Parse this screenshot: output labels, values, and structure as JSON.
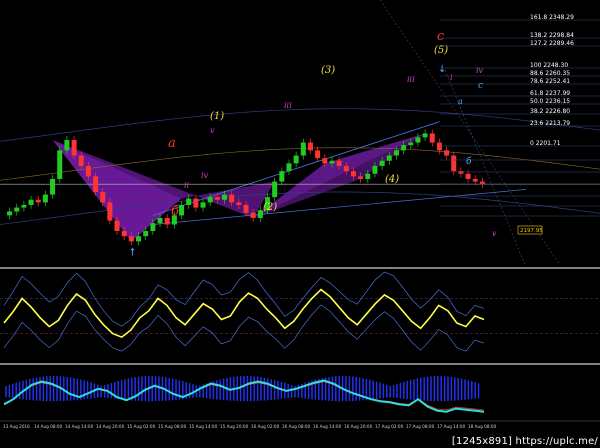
{
  "watermark": "[1245x891] https://uplc.me/",
  "colors": {
    "background": "#000000",
    "bull_candle": "#22cc22",
    "bear_candle": "#ff3333",
    "pattern_fill": "#7a1fb0",
    "channel": "#4a6fd8",
    "fib_line": "#3a4a70",
    "stoch_main": "#ffff44",
    "osc_line": "#33dddd",
    "histogram": "#2233ff",
    "wave_yellow": "#f0e040",
    "wave_magenta": "#cc44cc",
    "wave_cyan": "#44aaff",
    "wave_red": "#ff3322"
  },
  "fib_labels": [
    "161.8 2348.29",
    "138.2 2298.84",
    "127.2 2289.46",
    "100 2248.30",
    "88.6 2260.35",
    "78.6 2252.41",
    "61.8 2237.99",
    "50.0 2236.15",
    "38.2 2226.80",
    "23.6 2213.79",
    "0 2201.71"
  ],
  "price_tag": "2197.95",
  "wave_labels": {
    "a1": "a",
    "b1": "б",
    "c1": "c",
    "w1": "(1)",
    "w2": "(2)",
    "w3": "(3)",
    "w4": "(4)",
    "w5": "(5)",
    "big_c": "c",
    "a2": "a",
    "b2": "б",
    "iii": "iii",
    "iv": "iv",
    "v": "v",
    "ii": "ii",
    "i": "i"
  },
  "time_labels": [
    "13 Aug 2016",
    "14 Aug 08:00",
    "14 Aug 14:00",
    "14 Aug 20:00",
    "15 Aug 02:00",
    "15 Aug 08:00",
    "15 Aug 14:00",
    "15 Aug 20:00",
    "16 Aug 02:00",
    "16 Aug 08:00",
    "16 Aug 14:00",
    "16 Aug 20:00",
    "17 Aug 02:00",
    "17 Aug 08:00",
    "17 Aug 14:00",
    "18 Aug 08:00"
  ],
  "chart_data": [
    {
      "type": "candlestick",
      "title": "",
      "xlabel": "",
      "ylabel": "",
      "ylim": [
        2190,
        2350
      ],
      "grid": false,
      "closes": [
        2215,
        2218,
        2220,
        2224,
        2222,
        2228,
        2240,
        2262,
        2270,
        2258,
        2250,
        2242,
        2230,
        2222,
        2208,
        2200,
        2196,
        2192,
        2196,
        2200,
        2206,
        2210,
        2205,
        2212,
        2220,
        2225,
        2218,
        2222,
        2226,
        2224,
        2228,
        2222,
        2220,
        2214,
        2210,
        2216,
        2226,
        2238,
        2246,
        2252,
        2258,
        2268,
        2262,
        2256,
        2252,
        2254,
        2250,
        2246,
        2242,
        2240,
        2244,
        2250,
        2254,
        2258,
        2262,
        2266,
        2268,
        2272,
        2275,
        2268,
        2262,
        2258,
        2246,
        2244,
        2240,
        2238,
        2236
      ]
    },
    {
      "type": "line",
      "title": "",
      "series": [
        {
          "values": [
            42,
            55,
            70,
            60,
            48,
            38,
            45,
            62,
            75,
            68,
            52,
            40,
            30,
            26,
            34,
            48,
            56,
            70,
            62,
            48,
            40,
            52,
            64,
            58,
            46,
            50,
            66,
            76,
            70,
            58,
            48,
            36,
            44,
            58,
            70,
            80,
            72,
            60,
            48,
            40,
            52,
            64,
            74,
            68,
            56,
            44,
            36,
            48,
            62,
            56,
            42,
            38,
            50,
            46
          ]
        }
      ],
      "ylim": [
        0,
        100
      ]
    },
    {
      "type": "line",
      "title": "",
      "series": [
        {
          "values": [
            30,
            40,
            55,
            68,
            74,
            70,
            62,
            50,
            44,
            52,
            60,
            56,
            44,
            38,
            46,
            58,
            66,
            60,
            50,
            44,
            52,
            62,
            70,
            66,
            58,
            62,
            70,
            74,
            70,
            62,
            56,
            60,
            66,
            72,
            76,
            70,
            60,
            52,
            46,
            40,
            36,
            34,
            30,
            28,
            40,
            26,
            18,
            16,
            22,
            20,
            18,
            16
          ]
        }
      ],
      "ylim": [
        0,
        100
      ]
    }
  ]
}
